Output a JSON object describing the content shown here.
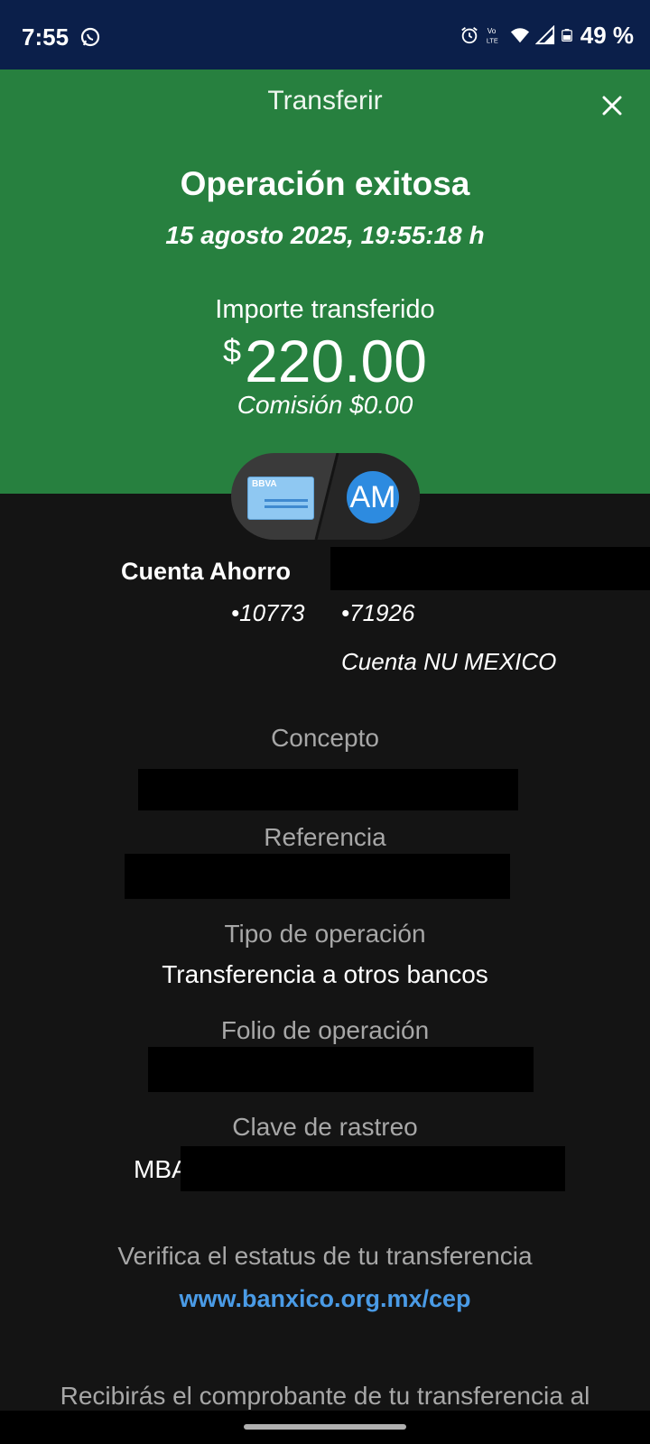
{
  "status_bar": {
    "time": "7:55",
    "battery": "49 %",
    "icons": [
      "whatsapp-icon",
      "alarm-icon",
      "volte-icon",
      "wifi-icon",
      "signal-icon",
      "battery-icon"
    ]
  },
  "header": {
    "title": "Transferir",
    "close_icon": "close-icon"
  },
  "result": {
    "title": "Operación exitosa",
    "datetime": "15 agosto 2025, 19:55:18 h",
    "amount_label": "Importe transferido",
    "currency_symbol": "$",
    "amount": "220.00",
    "fee": "Comisión  $0.00"
  },
  "accounts": {
    "source_card_label": "BBVA",
    "dest_avatar": "AM",
    "source_name": "Cuenta Ahorro",
    "source_number": "•10773",
    "dest_number": "•71926",
    "dest_bank": "Cuenta NU MEXICO"
  },
  "details": {
    "concept_label": "Concepto",
    "reference_label": "Referencia",
    "type_label": "Tipo de operación",
    "type_value": "Transferencia a otros bancos",
    "folio_label": "Folio de operación",
    "tracking_label": "Clave de rastreo",
    "tracking_prefix": "MBA"
  },
  "footer": {
    "verify_text": "Verifica el estatus de tu transferencia",
    "verify_link": "www.banxico.org.mx/cep",
    "receipt_text": "Recibirás el comprobante de tu transferencia al"
  },
  "colors": {
    "status_bar": "#0b1f4a",
    "header_green": "#27803f",
    "background": "#141414",
    "link": "#4a9be6",
    "avatar": "#2d8be0"
  }
}
